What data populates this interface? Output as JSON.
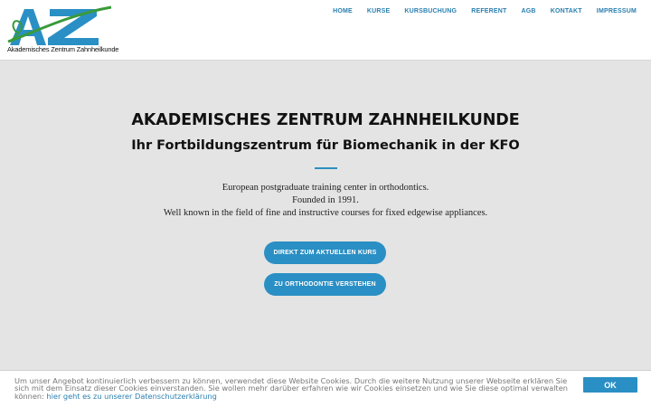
{
  "header": {
    "logo_text": "Akademisches Zentrum Zahnheilkunde",
    "nav": [
      "HOME",
      "KURSE",
      "KURSBUCHUNG",
      "REFERENT",
      "AGB",
      "KONTAKT",
      "IMPRESSUM"
    ]
  },
  "hero": {
    "title": "AKADEMISCHES ZENTRUM ZAHNHEILKUNDE",
    "subtitle": "Ihr Fortbildungszentrum für Biomechanik in der KFO",
    "lines": [
      "European postgraduate training center in orthodontics.",
      "Founded in 1991.",
      "Well known in the field of fine and instructive courses for fixed edgewise appliances."
    ],
    "button_current_course": "DIREKT ZUM AKTUELLEN KURS",
    "button_orthodontics": "ZU ORTHODONTIE VERSTEHEN"
  },
  "cookie": {
    "text": "Um unser Angebot kontinuierlich verbessern zu können, verwendet diese Website Cookies. Durch die weitere Nutzung unserer Webseite erklären Sie sich mit dem Einsatz dieser Cookies einverstanden. Sie wollen mehr darüber erfahren wie wir Cookies einsetzen und wie Sie diese optimal verwalten können:",
    "link": "hier geht es zu unserer Datenschutzerklärung",
    "ok": "OK"
  },
  "colors": {
    "accent": "#2a8fc4",
    "logo_blue": "#2a8fc4",
    "logo_green": "#3a9a3a",
    "hero_bg": "#e4e4e4"
  }
}
